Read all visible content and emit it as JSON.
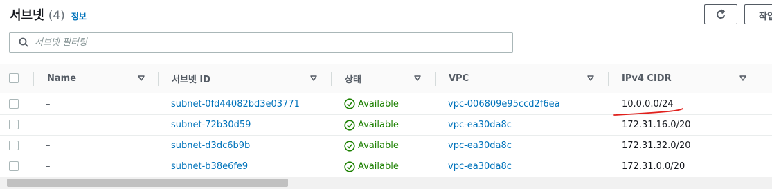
{
  "header": {
    "title": "서브넷",
    "count": "(4)",
    "info_link": "정보",
    "create_label": "작업"
  },
  "search": {
    "placeholder": "서브넷 필터링"
  },
  "columns": [
    "Name",
    "서브넷 ID",
    "상태",
    "VPC",
    "IPv4 CIDR"
  ],
  "rows": [
    {
      "name": "–",
      "subnet_id": "subnet-0fd44082bd3e03771",
      "status": "Available",
      "vpc": "vpc-006809e95ccd2f6ea",
      "cidr": "10.0.0.0/24"
    },
    {
      "name": "–",
      "subnet_id": "subnet-72b30d59",
      "status": "Available",
      "vpc": "vpc-ea30da8c",
      "cidr": "172.31.16.0/20"
    },
    {
      "name": "–",
      "subnet_id": "subnet-d3dc6b9b",
      "status": "Available",
      "vpc": "vpc-ea30da8c",
      "cidr": "172.31.32.0/20"
    },
    {
      "name": "–",
      "subnet_id": "subnet-b38e6fe9",
      "status": "Available",
      "vpc": "vpc-ea30da8c",
      "cidr": "172.31.0.0/20"
    }
  ],
  "colors": {
    "link": "#0073bb",
    "status_ok": "#1d8102",
    "annotation": "#e0201c"
  },
  "icons": {
    "refresh": "refresh-icon",
    "search": "search-icon",
    "sort": "sort-caret-icon",
    "status": "check-circle-icon"
  }
}
